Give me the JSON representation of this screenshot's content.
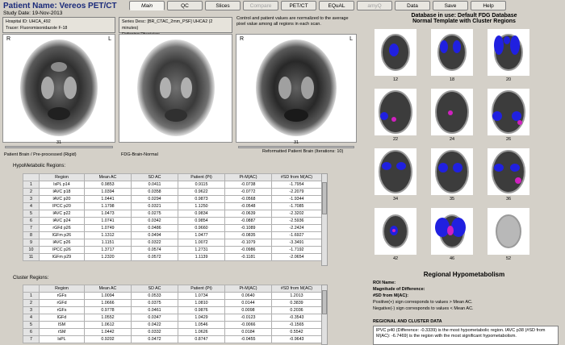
{
  "header": {
    "title": "Patient Name: Vereos PET/CT",
    "study_date": "Study Date: 19-Nov-2013"
  },
  "tabs": [
    {
      "label": "Main",
      "state": "active"
    },
    {
      "label": "QC",
      "state": "normal"
    },
    {
      "label": "Slices",
      "state": "normal"
    },
    {
      "label": "Compare",
      "state": "disabled"
    },
    {
      "label": "PET/CT",
      "state": "normal"
    },
    {
      "label": "EQuAL",
      "state": "normal"
    },
    {
      "label": "amyQ",
      "state": "disabled"
    },
    {
      "label": "Data",
      "state": "normal"
    },
    {
      "label": "Save",
      "state": "normal"
    },
    {
      "label": "Help",
      "state": "normal"
    }
  ],
  "info": {
    "hospital_id": "Hospital ID: UHCA_492",
    "tracer": "Tracer: Fluoromisonidazole F-18",
    "series_desc": "Series Desc: [BR_CTAC_2mm_PSF] UHCA2 (2 minutes)",
    "referring": "Referring Physician:",
    "note": "Control and patient values are normalized to the average pixel value among all regions in each scan."
  },
  "panels": {
    "r_label": "R",
    "l_label": "L",
    "p1_slice": "31",
    "p1_caption": "Patient Brain / Pre-processed (Rigid)",
    "p2_caption": "FDG-Brain-Normal",
    "p3_slice": "31",
    "p3_caption": "Reformatted Patient Brain (Iterations: 10)"
  },
  "hypo": {
    "label": "HypoMetabolic Regions:",
    "columns": [
      "Region",
      "Mean AC",
      "SD AC",
      "Patient (Pt)",
      "Pt-M(AC)",
      "#SD from M(AC)"
    ],
    "rows": [
      [
        "1",
        "lsPL p14",
        "0.9853",
        "0.0411",
        "0.9115",
        "-0.0738",
        "-1.7954"
      ],
      [
        "2",
        "lAVC p18",
        "1.0394",
        "0.0358",
        "0.9622",
        "-0.0772",
        "-2.2079"
      ],
      [
        "3",
        "lAVC p20",
        "1.0441",
        "0.0294",
        "0.9873",
        "-0.0568",
        "-1.9344"
      ],
      [
        "4",
        "lPCC p20",
        "1.1798",
        "0.0321",
        "1.1250",
        "-0.0548",
        "-1.7085"
      ],
      [
        "5",
        "lAVC p22",
        "1.0473",
        "0.0275",
        "0.9834",
        "-0.0639",
        "-2.3202"
      ],
      [
        "6",
        "lAVC p24",
        "1.0741",
        "0.0342",
        "0.9854",
        "-0.0887",
        "-2.5936"
      ],
      [
        "7",
        "rGFd p26",
        "1.0749",
        "0.0486",
        "0.9660",
        "-0.1089",
        "-2.2424"
      ],
      [
        "8",
        "lGFm p26",
        "1.1312",
        "0.0494",
        "1.0477",
        "-0.0835",
        "-1.6927"
      ],
      [
        "9",
        "lAVC p26",
        "1.1151",
        "0.0322",
        "1.0072",
        "-0.1079",
        "-3.3491"
      ],
      [
        "10",
        "lPCC p26",
        "1.3717",
        "0.0574",
        "1.2731",
        "-0.0986",
        "-1.7192"
      ],
      [
        "11",
        "lGFm p29",
        "1.2320",
        "0.0572",
        "1.1139",
        "-0.1181",
        "-2.0654"
      ]
    ]
  },
  "cluster": {
    "label": "Cluster Regions:",
    "columns": [
      "Region",
      "Mean AC",
      "SD AC",
      "Patient (Pt)",
      "Pt-M(AC)",
      "#SD from M(AC)"
    ],
    "rows": [
      [
        "1",
        "rGFs",
        "1.0094",
        "0.0533",
        "1.0734",
        "0.0640",
        "1.2013"
      ],
      [
        "2",
        "rGFd",
        "1.0666",
        "0.0375",
        "1.0810",
        "0.0144",
        "0.3839"
      ],
      [
        "3",
        "rGFs",
        "0.9778",
        "0.0461",
        "0.9876",
        "0.0098",
        "0.2036"
      ],
      [
        "4",
        "lGFd",
        "1.0552",
        "0.0347",
        "1.0429",
        "-0.0123",
        "-0.3543"
      ],
      [
        "5",
        "lSM",
        "1.0612",
        "0.0422",
        "1.0546",
        "-0.0066",
        "-0.1565"
      ],
      [
        "6",
        "rSM",
        "1.0442",
        "0.0332",
        "1.0626",
        "0.0184",
        "0.5542"
      ],
      [
        "7",
        "lsPL",
        "0.9202",
        "0.0472",
        "0.8747",
        "-0.0455",
        "-0.9643"
      ]
    ]
  },
  "database": {
    "line1": "Database in use: Default FDG Database",
    "line2": "Normal Template with Cluster Regions",
    "slices": [
      "12",
      "18",
      "20",
      "22",
      "24",
      "26",
      "34",
      "35",
      "36",
      "42",
      "46",
      "52"
    ]
  },
  "regional": {
    "title": "Regional Hypometabolism",
    "roi": "ROI Name:",
    "magnitude": "Magnitude of Difference:",
    "sd": "#SD from M(AC):",
    "positive": "Positive(+) sign corresponds to values > Mean AC.",
    "negative": "Negative(-) sign corresponds to values < Mean AC.",
    "cluster_header": "REGIONAL AND CLUSTER DATA",
    "result": "lPVC p40 (Difference: -0.3339) is the most hypometabolic region. lAVC p38 (#SD from M(AC): -6.7469) is the region with the most significant hypometabolism."
  },
  "colors": {
    "accent_blue": "#1a2a7a",
    "cluster_blue": "#2020e0",
    "cluster_magenta": "#d020c0"
  }
}
